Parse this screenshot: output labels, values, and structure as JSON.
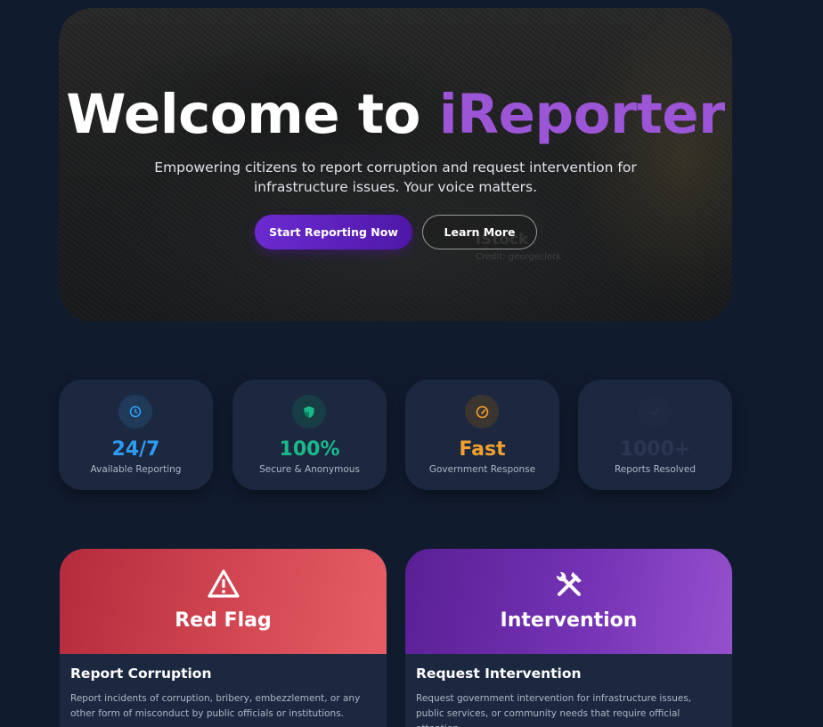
{
  "hero": {
    "title_prefix": "Welcome to",
    "title_brand": "iReporter",
    "subtitle": "Empowering citizens to report corruption and request intervention for infrastructure issues. Your voice matters.",
    "primary_button": "Start Reporting Now",
    "secondary_button": "Learn More",
    "watermark": "iStock",
    "watermark_credit": "Credit: georgeclerk"
  },
  "stats": [
    {
      "value": "24/7",
      "label": "Available Reporting",
      "icon": "clock-icon",
      "color": "#2f9cf4"
    },
    {
      "value": "100%",
      "label": "Secure & Anonymous",
      "icon": "shield-icon",
      "color": "#19b98a"
    },
    {
      "value": "Fast",
      "label": "Government Response",
      "icon": "speedometer-icon",
      "color": "#f1a02e"
    },
    {
      "value": "1000+",
      "label": "Reports Resolved",
      "icon": "check-icon",
      "color": "#2b3750"
    }
  ],
  "types": [
    {
      "head_title": "Red Flag",
      "icon": "warning-icon",
      "body_title": "Report Corruption",
      "body_text": "Report incidents of corruption, bribery, embezzlement, or any other form of misconduct by public officials or institutions."
    },
    {
      "head_title": "Intervention",
      "icon": "tools-icon",
      "body_title": "Request Intervention",
      "body_text": "Request government intervention for infrastructure issues, public services, or community needs that require official attention."
    }
  ]
}
